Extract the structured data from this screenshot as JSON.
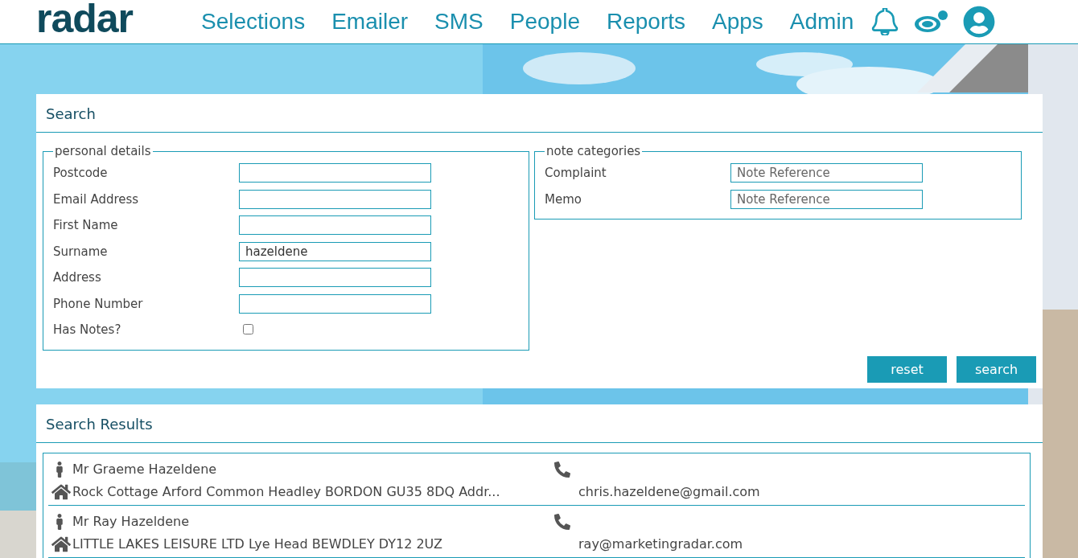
{
  "logo": "radar",
  "nav": [
    "Selections",
    "Emailer",
    "SMS",
    "People",
    "Reports",
    "Apps",
    "Admin"
  ],
  "search": {
    "title": "Search",
    "personal_details": {
      "legend": "personal details",
      "fields": [
        {
          "label": "Postcode"
        },
        {
          "label": "Email Address"
        },
        {
          "label": "First Name"
        },
        {
          "label": "Surname",
          "value": "hazeldene"
        },
        {
          "label": "Address"
        },
        {
          "label": "Phone Number"
        }
      ],
      "has_notes": {
        "label": "Has Notes?",
        "checked": false
      }
    },
    "note_categories": {
      "legend": "note categories",
      "fields": [
        {
          "label": "Complaint",
          "placeholder": "Note Reference"
        },
        {
          "label": "Memo",
          "placeholder": "Note Reference"
        }
      ]
    },
    "buttons": [
      "reset",
      "search"
    ]
  },
  "results": {
    "title": "Search Results",
    "rows": [
      {
        "name": "Mr Graeme Hazeldene",
        "address": "Rock Cottage Arford Common Headley BORDON GU35 8DQ Addr...",
        "email": "chris.hazeldene@gmail.com"
      },
      {
        "name": "Mr Ray Hazeldene",
        "address": "LITTLE LAKES LEISURE LTD Lye Head BEWDLEY DY12 2UZ",
        "email": "ray@marketingradar.com"
      }
    ]
  }
}
